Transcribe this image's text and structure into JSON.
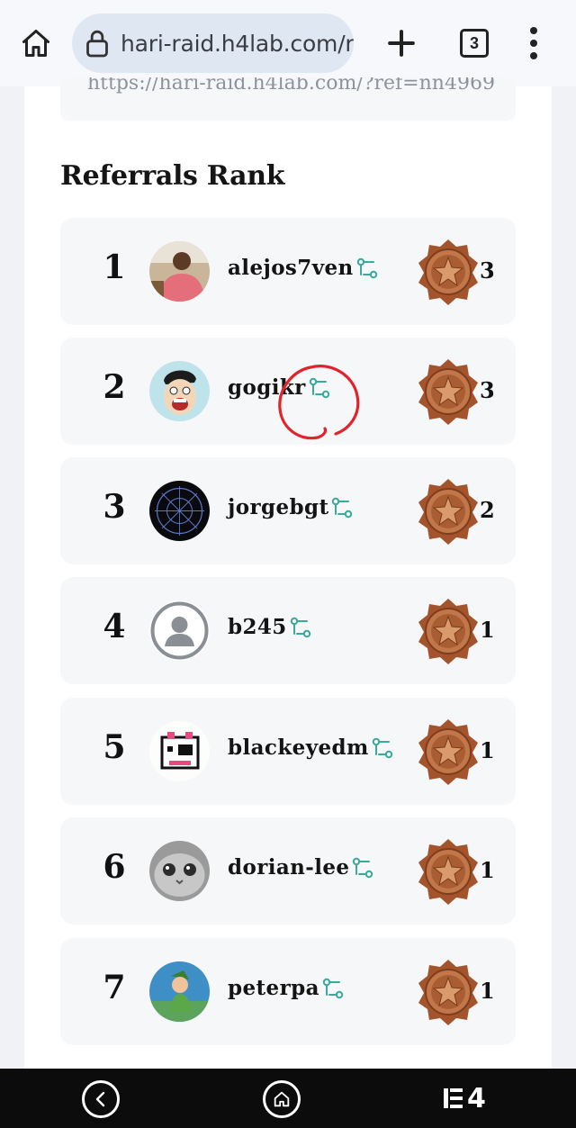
{
  "browser": {
    "url": "hari-raid.h4lab.com/r",
    "tab_count": "3"
  },
  "referral_link": "https://hari-raid.h4lab.com/?ref=nn4969",
  "section_title": "Referrals Rank",
  "accent_color": "#3aaa9b",
  "medal_color": "#b5643a",
  "ranks": [
    {
      "rank": "1",
      "username": "alejos7ven",
      "count": "3",
      "avatar": "person-photo"
    },
    {
      "rank": "2",
      "username": "gogikr",
      "count": "3",
      "avatar": "cartoon-face"
    },
    {
      "rank": "3",
      "username": "jorgebgt",
      "count": "2",
      "avatar": "dark-compass"
    },
    {
      "rank": "4",
      "username": "b245",
      "count": "1",
      "avatar": "default-user-icon"
    },
    {
      "rank": "5",
      "username": "blackeyedm",
      "count": "1",
      "avatar": "pixel-cat"
    },
    {
      "rank": "6",
      "username": "dorian-lee",
      "count": "1",
      "avatar": "gray-cat"
    },
    {
      "rank": "7",
      "username": "peterpa",
      "count": "1",
      "avatar": "peter-pan"
    }
  ],
  "bottom_nav": {
    "logo_text": "4"
  }
}
